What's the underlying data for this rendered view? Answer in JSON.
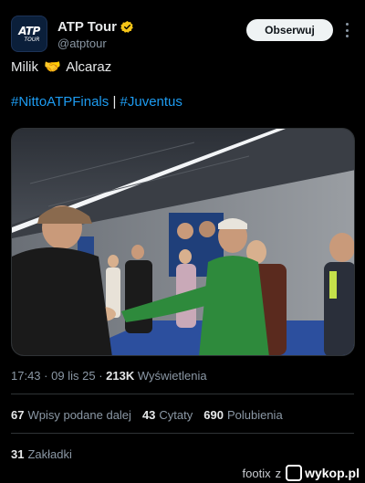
{
  "account": {
    "display_name": "ATP Tour",
    "handle": "@atptour",
    "avatar_line1": "ATP",
    "avatar_line2": "TOUR",
    "verified_color": "#f5c518"
  },
  "follow_label": "Obserwuj",
  "tweet": {
    "text_left": "Milik",
    "emoji": "🤝",
    "text_right": "Alcaraz",
    "hashtag1": "#NittoATPFinals",
    "separator": "|",
    "hashtag2": "#Juventus"
  },
  "meta": {
    "time": "17:43",
    "dot1": "·",
    "date": "09 lis 25",
    "dot2": "·",
    "views_count": "213K",
    "views_label": "Wyświetlenia"
  },
  "stats": {
    "reposts_count": "67",
    "reposts_label": "Wpisy podane dalej",
    "quotes_count": "43",
    "quotes_label": "Cytaty",
    "likes_count": "690",
    "likes_label": "Polubienia"
  },
  "bookmarks": {
    "count": "31",
    "label": "Zakładki"
  },
  "watermark": {
    "user": "footix",
    "prep": "z",
    "site": "wykop.pl"
  },
  "colors": {
    "background": "#000000",
    "text": "#e7e9ea",
    "secondary": "#8b98a5",
    "link": "#1d9bf0",
    "divider": "#2f3336"
  }
}
